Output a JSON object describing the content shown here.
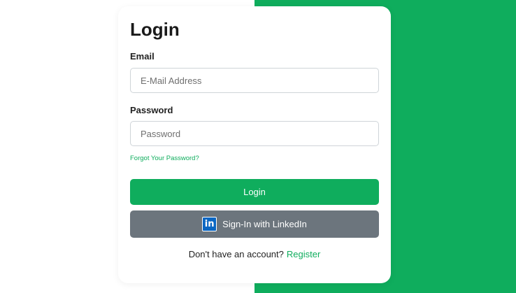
{
  "login": {
    "title": "Login",
    "email_label": "Email",
    "email_placeholder": "E-Mail Address",
    "password_label": "Password",
    "password_placeholder": "Password",
    "forgot_link": "Forgot Your Password?",
    "login_button": "Login",
    "linkedin_icon_text": "in",
    "linkedin_button": "Sign-In with LinkedIn",
    "footer_text": "Don't have an account?",
    "register_link": "Register"
  },
  "colors": {
    "accent": "#0fad5d",
    "secondary_button": "#6c757d",
    "linkedin_brand": "#0a66c2"
  },
  "icons": {
    "linkedin": "linkedin-icon"
  }
}
